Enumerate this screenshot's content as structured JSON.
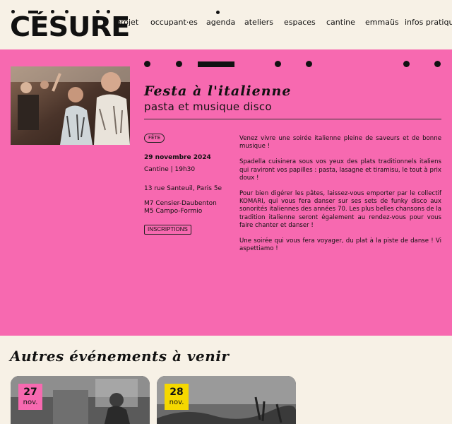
{
  "header": {
    "logo_text": "CÉSURE",
    "nav": [
      {
        "label": "projet"
      },
      {
        "label": "occupant·es"
      },
      {
        "label": "agenda"
      },
      {
        "label": "ateliers"
      },
      {
        "label": "espaces"
      },
      {
        "label": "cantine"
      },
      {
        "label": "emmaüs"
      },
      {
        "label": "infos pratiques"
      }
    ],
    "active_nav": "agenda"
  },
  "event": {
    "title": "Festa à l'italienne",
    "subtitle": "pasta et musique disco",
    "tag": "FÊTE",
    "date": "29 novembre 2024",
    "time": "Cantine | 19h30",
    "address": "13 rue Santeuil, Paris 5e",
    "metro": [
      "M7 Censier-Daubenton",
      "M5 Campo-Formio"
    ],
    "button": "INSCRIPTIONS",
    "description": [
      "Venez vivre une soirée italienne pleine de saveurs et de bonne musique !",
      "Spadella cuisinera sous vos yeux des plats traditionnels italiens qui raviront vos papilles : pasta, lasagne et tiramisu, le tout à prix doux !",
      "Pour bien digérer les pâtes, laissez-vous emporter par le collectif KOMARI, qui vous fera danser sur ses sets de funky disco aux sonorités italiennes des années 70. Les plus belles chansons de la tradition italienne seront également au rendez-vous pour vous faire chanter et danser !",
      "Une soirée qui vous fera voyager, du plat à la piste de danse ! Vi aspettiamo !"
    ]
  },
  "upcoming": {
    "title": "Autres événements à venir",
    "cards": [
      {
        "day": "27",
        "month": "nov."
      },
      {
        "day": "28",
        "month": "nov."
      }
    ]
  },
  "colors": {
    "background": "#f7f1e6",
    "pink": "#f769b0",
    "yellow": "#f5d800",
    "ink": "#111111"
  }
}
